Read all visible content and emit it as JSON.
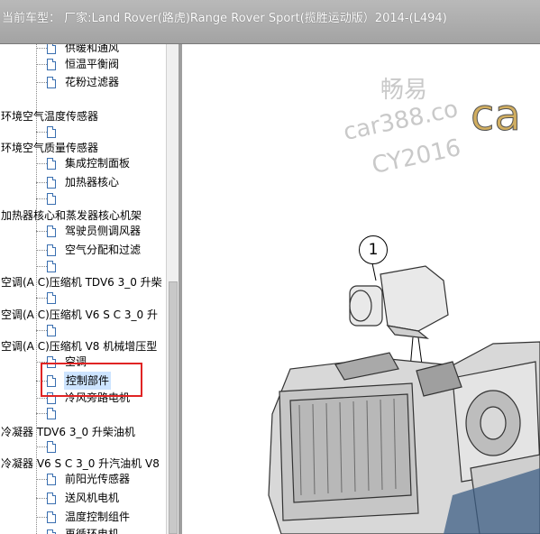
{
  "title_bar": {
    "text": "当前车型：  厂家:Land Rover(路虎)Range Rover Sport(揽胜运动版）2014-(L494)"
  },
  "tree": {
    "items": [
      {
        "label": "供暖和通风"
      },
      {
        "label": "恒温平衡阀"
      },
      {
        "label": "花粉过滤器"
      },
      {
        "label": "环境空气温度传感器"
      },
      {
        "label": ""
      },
      {
        "label": "环境空气质量传感器"
      },
      {
        "label": "集成控制面板"
      },
      {
        "label": "加热器核心"
      },
      {
        "label": ""
      },
      {
        "label": "加热器核心和蒸发器核心机架"
      },
      {
        "label": "驾驶员侧调风器"
      },
      {
        "label": "空气分配和过滤"
      },
      {
        "label": ""
      },
      {
        "label": "空调(A C)压缩机 TDV6 3_0 升柴"
      },
      {
        "label": ""
      },
      {
        "label": "空调(A C)压缩机 V6 S C 3_0 升"
      },
      {
        "label": ""
      },
      {
        "label": "空调(A C)压缩机 V8 机械增压型"
      },
      {
        "label": "空调"
      },
      {
        "label": "控制部件"
      },
      {
        "label": "冷风旁路电机"
      },
      {
        "label": ""
      },
      {
        "label": "冷凝器 TDV6 3_0 升柴油机"
      },
      {
        "label": ""
      },
      {
        "label": "冷凝器 V6 S C 3_0 升汽油机 V8"
      },
      {
        "label": "前阳光传感器"
      },
      {
        "label": "送风机电机"
      },
      {
        "label": "温度控制组件"
      },
      {
        "label": "再循环电机"
      }
    ],
    "selected_label": "控制部件"
  },
  "diagram": {
    "callout_number": "1",
    "watermark_text": [
      "畅易",
      "car388.co",
      "CY2016",
      "car"
    ]
  },
  "colors": {
    "highlight_box": "#e02424",
    "selection": "#cde4ff",
    "title_bg": "#aaaaaa"
  }
}
